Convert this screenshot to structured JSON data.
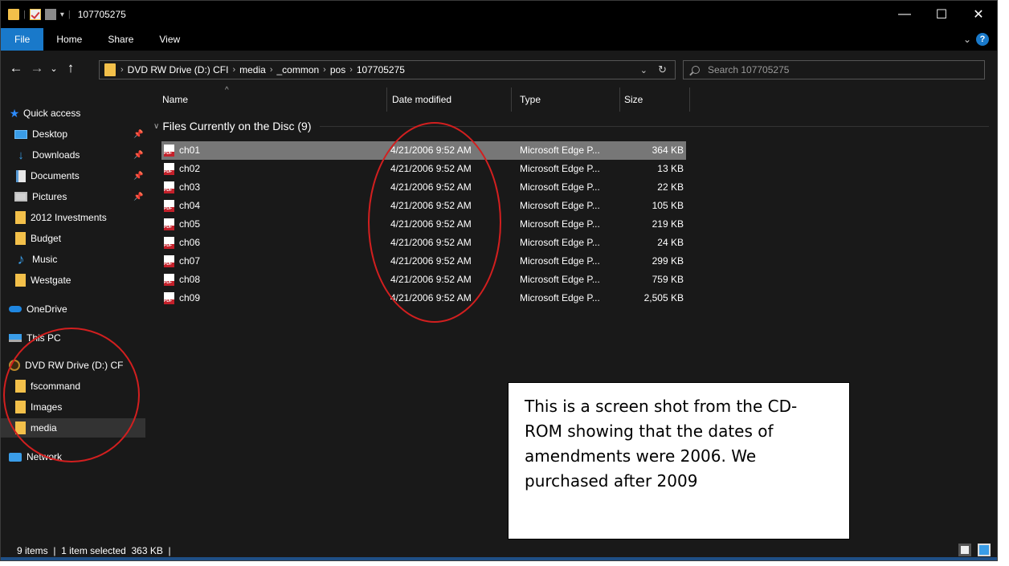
{
  "window": {
    "title": "107705275",
    "controls": [
      "—",
      "☐",
      "✕"
    ]
  },
  "ribbon": {
    "tabs": [
      "File",
      "Home",
      "Share",
      "View"
    ]
  },
  "address": {
    "crumbs": [
      "DVD RW Drive (D:) CFI",
      "media",
      "_common",
      "pos",
      "107705275"
    ],
    "search_placeholder": "Search 107705275"
  },
  "nav": {
    "items": [
      {
        "label": "Quick access",
        "icon": "star-icon"
      },
      {
        "label": "Desktop",
        "icon": "desktop-icon",
        "pinned": true
      },
      {
        "label": "Downloads",
        "icon": "download-icon",
        "pinned": true
      },
      {
        "label": "Documents",
        "icon": "documents-icon",
        "pinned": true
      },
      {
        "label": "Pictures",
        "icon": "pictures-icon",
        "pinned": true
      },
      {
        "label": "2012 Investments",
        "icon": "folder-icon"
      },
      {
        "label": "Budget",
        "icon": "folder-icon"
      },
      {
        "label": "Music",
        "icon": "music-icon"
      },
      {
        "label": "Westgate",
        "icon": "folder-icon"
      },
      {
        "label": "OneDrive",
        "icon": "onedrive-icon"
      },
      {
        "label": "This PC",
        "icon": "pc-icon"
      },
      {
        "label": "DVD RW Drive (D:) CF",
        "icon": "dvd-icon"
      },
      {
        "label": "fscommand",
        "icon": "folder-icon"
      },
      {
        "label": "Images",
        "icon": "folder-icon"
      },
      {
        "label": "media",
        "icon": "folder-icon",
        "selected": true
      },
      {
        "label": "Network",
        "icon": "network-icon"
      }
    ]
  },
  "columns": {
    "name": "Name",
    "date": "Date modified",
    "type": "Type",
    "size": "Size"
  },
  "group_label": "Files Currently on the Disc (9)",
  "files": [
    {
      "name": "ch01",
      "date": "4/21/2006 9:52 AM",
      "type": "Microsoft Edge P...",
      "size": "364 KB",
      "selected": true
    },
    {
      "name": "ch02",
      "date": "4/21/2006 9:52 AM",
      "type": "Microsoft Edge P...",
      "size": "13 KB"
    },
    {
      "name": "ch03",
      "date": "4/21/2006 9:52 AM",
      "type": "Microsoft Edge P...",
      "size": "22 KB"
    },
    {
      "name": "ch04",
      "date": "4/21/2006 9:52 AM",
      "type": "Microsoft Edge P...",
      "size": "105 KB"
    },
    {
      "name": "ch05",
      "date": "4/21/2006 9:52 AM",
      "type": "Microsoft Edge P...",
      "size": "219 KB"
    },
    {
      "name": "ch06",
      "date": "4/21/2006 9:52 AM",
      "type": "Microsoft Edge P...",
      "size": "24 KB"
    },
    {
      "name": "ch07",
      "date": "4/21/2006 9:52 AM",
      "type": "Microsoft Edge P...",
      "size": "299 KB"
    },
    {
      "name": "ch08",
      "date": "4/21/2006 9:52 AM",
      "type": "Microsoft Edge P...",
      "size": "759 KB"
    },
    {
      "name": "ch09",
      "date": "4/21/2006 9:52 AM",
      "type": "Microsoft Edge P...",
      "size": "2,505 KB"
    }
  ],
  "status": "9 items  |  1 item selected  363 KB  |",
  "annotation": "This is a screen shot from the CD-ROM showing that the dates of amendments were 2006.  We purchased after 2009",
  "colors": {
    "accent": "#1979ca",
    "highlight": "#d21f1f"
  }
}
